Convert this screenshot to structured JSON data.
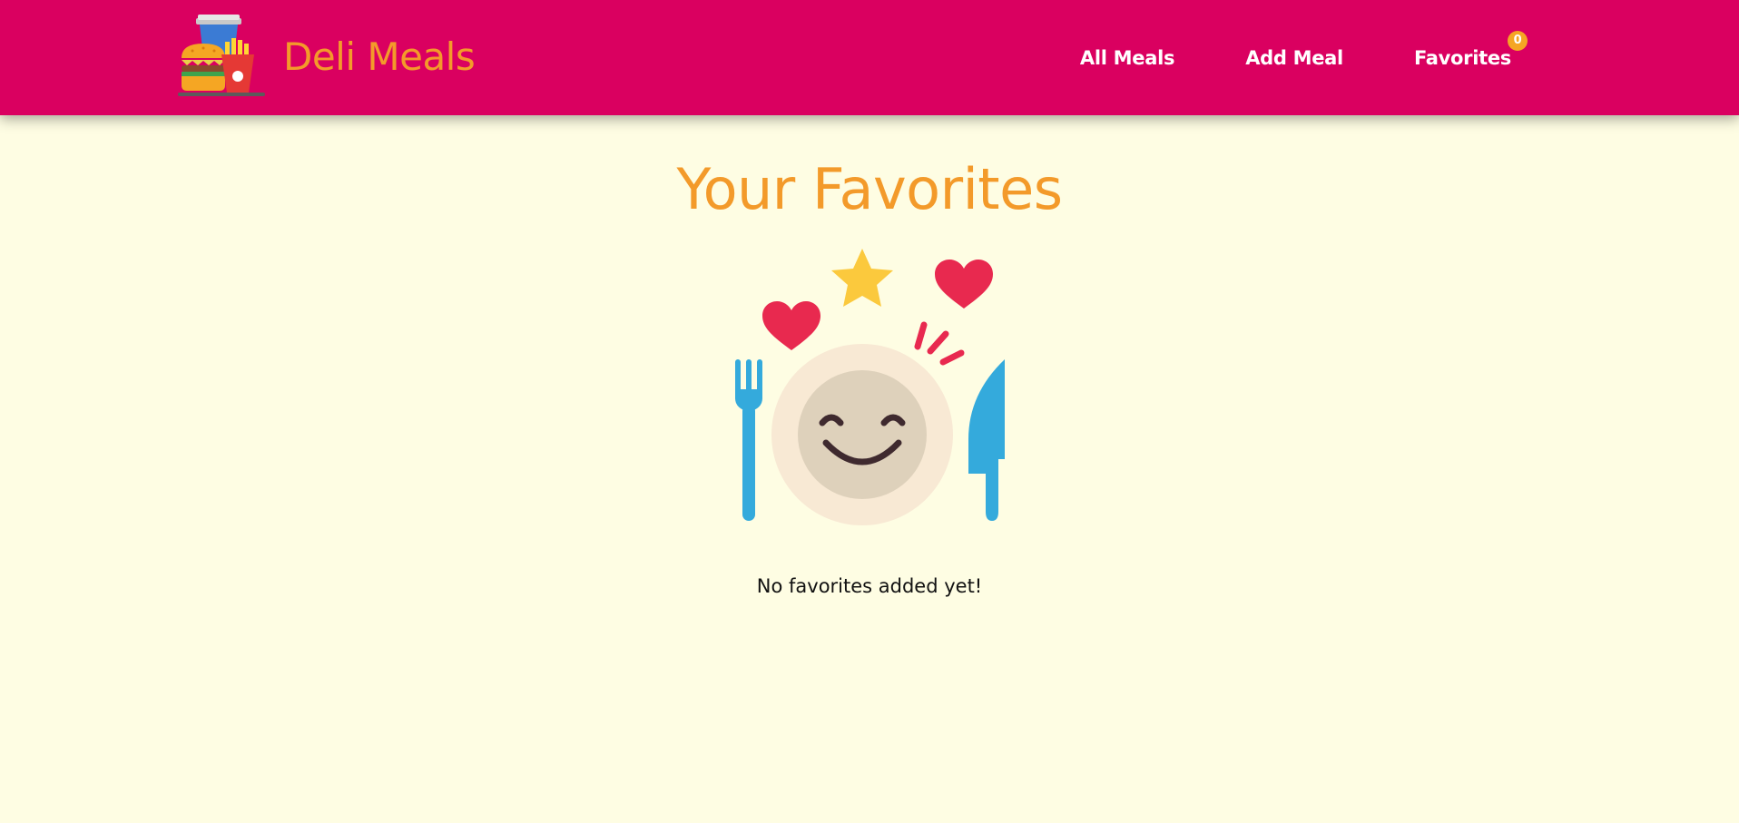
{
  "app": {
    "title": "Deli Meals",
    "logo_icon": "food-combo-icon"
  },
  "nav": {
    "items": [
      {
        "label": "All Meals"
      },
      {
        "label": "Add Meal"
      },
      {
        "label": "Favorites",
        "badge": "0"
      }
    ]
  },
  "main": {
    "title": "Your Favorites",
    "empty_message": "No favorites added yet!",
    "illustration_icon": "happy-plate-icon"
  },
  "colors": {
    "header": "#da0060",
    "accent": "#f39a2a",
    "background": "#fefde3",
    "badge": "#f5a623"
  }
}
